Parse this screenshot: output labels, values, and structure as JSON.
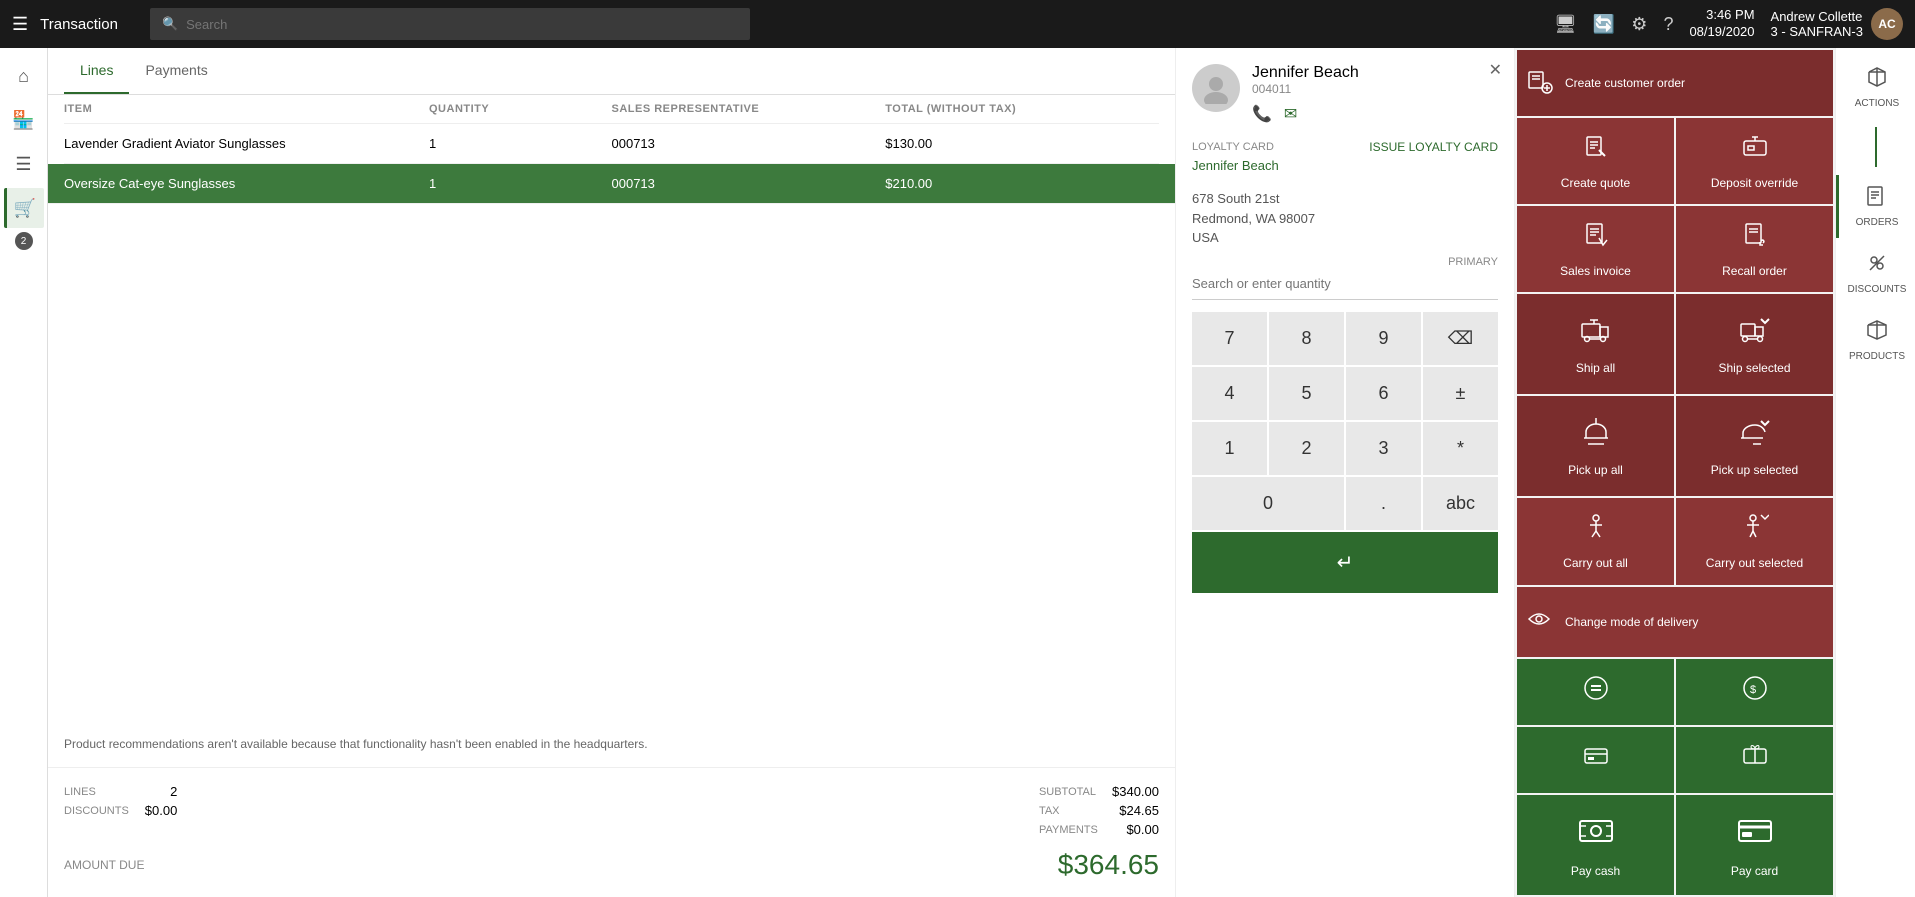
{
  "topbar": {
    "hamburger": "☰",
    "title": "Transaction",
    "search_placeholder": "Search",
    "time": "3:46 PM",
    "date": "08/19/2020",
    "user": "Andrew Collette",
    "store": "3 - SANFRAN-3",
    "avatar_initials": "AC"
  },
  "tabs": {
    "lines_label": "Lines",
    "payments_label": "Payments"
  },
  "table": {
    "headers": [
      "ITEM",
      "QUANTITY",
      "SALES REPRESENTATIVE",
      "TOTAL (WITHOUT TAX)"
    ],
    "rows": [
      {
        "item": "Lavender Gradient Aviator Sunglasses",
        "quantity": "1",
        "rep": "000713",
        "total": "$130.00",
        "selected": false
      },
      {
        "item": "Oversize Cat-eye Sunglasses",
        "quantity": "1",
        "rep": "000713",
        "total": "$210.00",
        "selected": true
      }
    ]
  },
  "info_message": "Product recommendations aren't available because that functionality hasn't been enabled in the headquarters.",
  "footer": {
    "lines_label": "LINES",
    "lines_value": "2",
    "discounts_label": "DISCOUNTS",
    "discounts_value": "$0.00",
    "subtotal_label": "SUBTOTAL",
    "subtotal_value": "$340.00",
    "tax_label": "TAX",
    "tax_value": "$24.65",
    "payments_label": "PAYMENTS",
    "payments_value": "$0.00",
    "amount_due_label": "AMOUNT DUE",
    "amount_due_value": "$364.65"
  },
  "customer": {
    "name": "Jennifer Beach",
    "id": "004011",
    "loyalty_card_label": "LOYALTY CARD",
    "issue_loyalty_label": "Issue loyalty card",
    "loyalty_name": "Jennifer Beach",
    "address_line1": "678 South 21st",
    "address_line2": "Redmond, WA 98007",
    "address_line3": "USA",
    "primary_label": "PRIMARY"
  },
  "numpad": {
    "search_placeholder": "Search or enter quantity",
    "buttons": [
      "7",
      "8",
      "9",
      "⌫",
      "4",
      "5",
      "6",
      "±",
      "1",
      "2",
      "3",
      "*",
      "0",
      ".",
      "abc"
    ],
    "enter_label": "↵"
  },
  "tiles": [
    {
      "id": "create-customer-order",
      "label": "Create customer order",
      "icon": "🛒",
      "color": "dark-red",
      "span": 1
    },
    {
      "id": "create-quote",
      "label": "Create quote",
      "icon": "📋",
      "color": "dark-red",
      "span": 1
    },
    {
      "id": "deposit-override",
      "label": "Deposit override",
      "icon": "💳",
      "color": "dark-red",
      "span": 1
    },
    {
      "id": "sales-invoice",
      "label": "Sales invoice",
      "icon": "🧾",
      "color": "dark-red",
      "span": 1
    },
    {
      "id": "recall-order",
      "label": "Recall order",
      "icon": "↩",
      "color": "dark-red",
      "span": 1
    },
    {
      "id": "ship-all",
      "label": "Ship all",
      "icon": "🚚",
      "color": "dark-red",
      "span": 1
    },
    {
      "id": "ship-selected",
      "label": "Ship selected",
      "icon": "📦",
      "color": "dark-red",
      "span": 1
    },
    {
      "id": "pick-up-all",
      "label": "Pick up all",
      "icon": "🛍",
      "color": "dark-red",
      "span": 1
    },
    {
      "id": "pick-up-selected",
      "label": "Pick up selected",
      "icon": "🛒",
      "color": "dark-red",
      "span": 1
    },
    {
      "id": "carry-out-all",
      "label": "Carry out all",
      "icon": "🏃",
      "color": "dark-red",
      "span": 1
    },
    {
      "id": "carry-out-selected",
      "label": "Carry out selected",
      "icon": "🚶",
      "color": "dark-red",
      "span": 1
    },
    {
      "id": "change-mode-delivery",
      "label": "Change mode of delivery",
      "icon": "🔄",
      "color": "dark-red",
      "span": 1
    },
    {
      "id": "pay-equals",
      "label": "",
      "icon": "⊜",
      "color": "green",
      "span": 1
    },
    {
      "id": "pay-loyalty",
      "label": "",
      "icon": "💰",
      "color": "green",
      "span": 1
    },
    {
      "id": "pay-card-small",
      "label": "",
      "icon": "🖼",
      "color": "green",
      "span": 1
    },
    {
      "id": "pay-gift",
      "label": "",
      "icon": "💌",
      "color": "green",
      "span": 1
    },
    {
      "id": "pay-cash",
      "label": "Pay cash",
      "icon": "💵",
      "color": "green-dark",
      "span": 1
    },
    {
      "id": "pay-card",
      "label": "Pay card",
      "icon": "💳",
      "color": "green-dark",
      "span": 1
    }
  ],
  "actions_column": {
    "items": [
      {
        "id": "actions",
        "label": "ACTIONS",
        "icon": "⚡"
      },
      {
        "id": "orders",
        "label": "ORDERS",
        "icon": "📄",
        "active": true
      },
      {
        "id": "discounts",
        "label": "DISCOUNTS",
        "icon": "🏷"
      },
      {
        "id": "products",
        "label": "PRODUCTS",
        "icon": "📦"
      }
    ]
  },
  "sidebar": {
    "items": [
      {
        "id": "home",
        "icon": "⌂"
      },
      {
        "id": "store",
        "icon": "🏪"
      },
      {
        "id": "menu",
        "icon": "☰"
      },
      {
        "id": "cart",
        "icon": "🛒",
        "active": true
      },
      {
        "id": "badge",
        "value": "2"
      }
    ]
  },
  "colors": {
    "dark_red": "#7B2D2D",
    "medium_red": "#8B3535",
    "green": "#2d6a2d",
    "medium_green": "#3d7a3d",
    "accent_green": "#4CAF50"
  }
}
